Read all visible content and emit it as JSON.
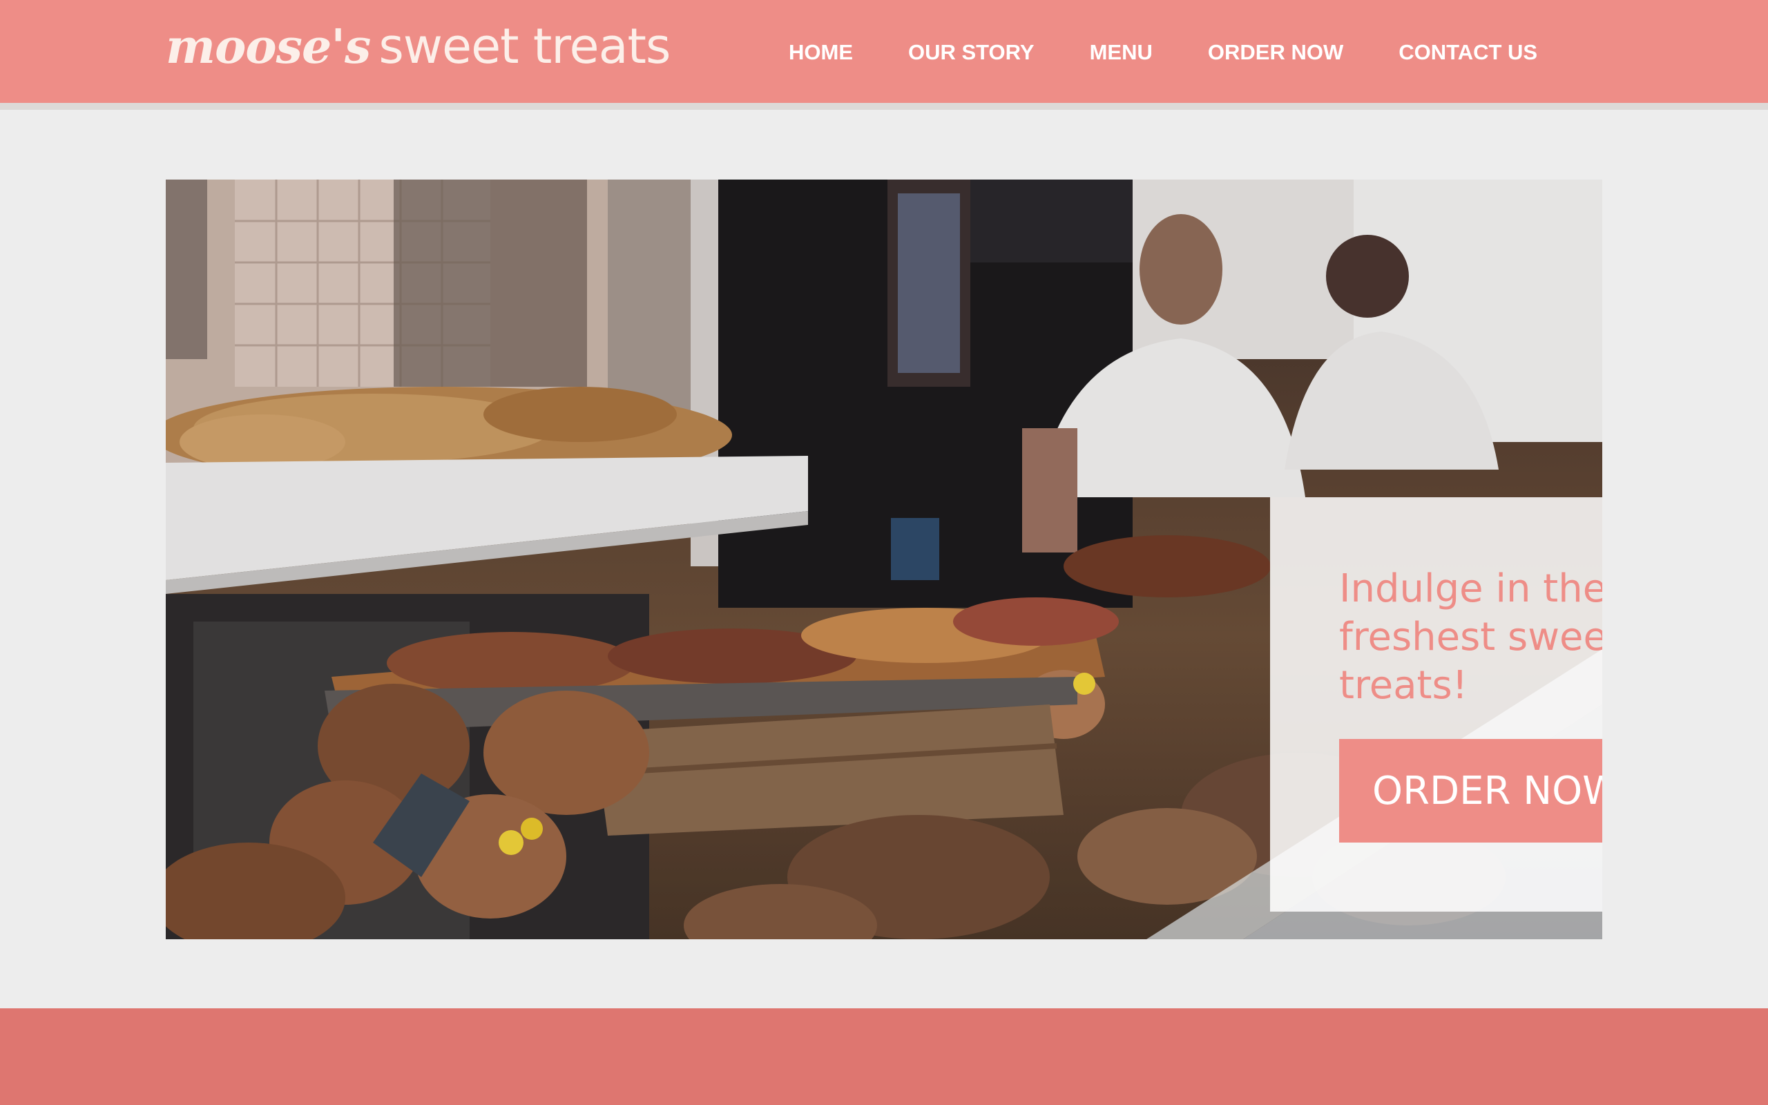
{
  "brand": {
    "script_part": "moose's",
    "plain_part": "sweet treats"
  },
  "nav": {
    "items": [
      {
        "label": "HOME"
      },
      {
        "label": "OUR STORY"
      },
      {
        "label": "MENU"
      },
      {
        "label": "ORDER NOW"
      },
      {
        "label": "CONTACT US"
      }
    ]
  },
  "hero": {
    "image": "bakery-display-photo",
    "headline": "Indulge in the freshest sweet treats!",
    "cta_label": "ORDER NOW!"
  },
  "colors": {
    "brand_pink": "#ee8d87",
    "footer_pink": "#de7670",
    "page_background": "#ededed",
    "card_background": "#ffffff"
  }
}
